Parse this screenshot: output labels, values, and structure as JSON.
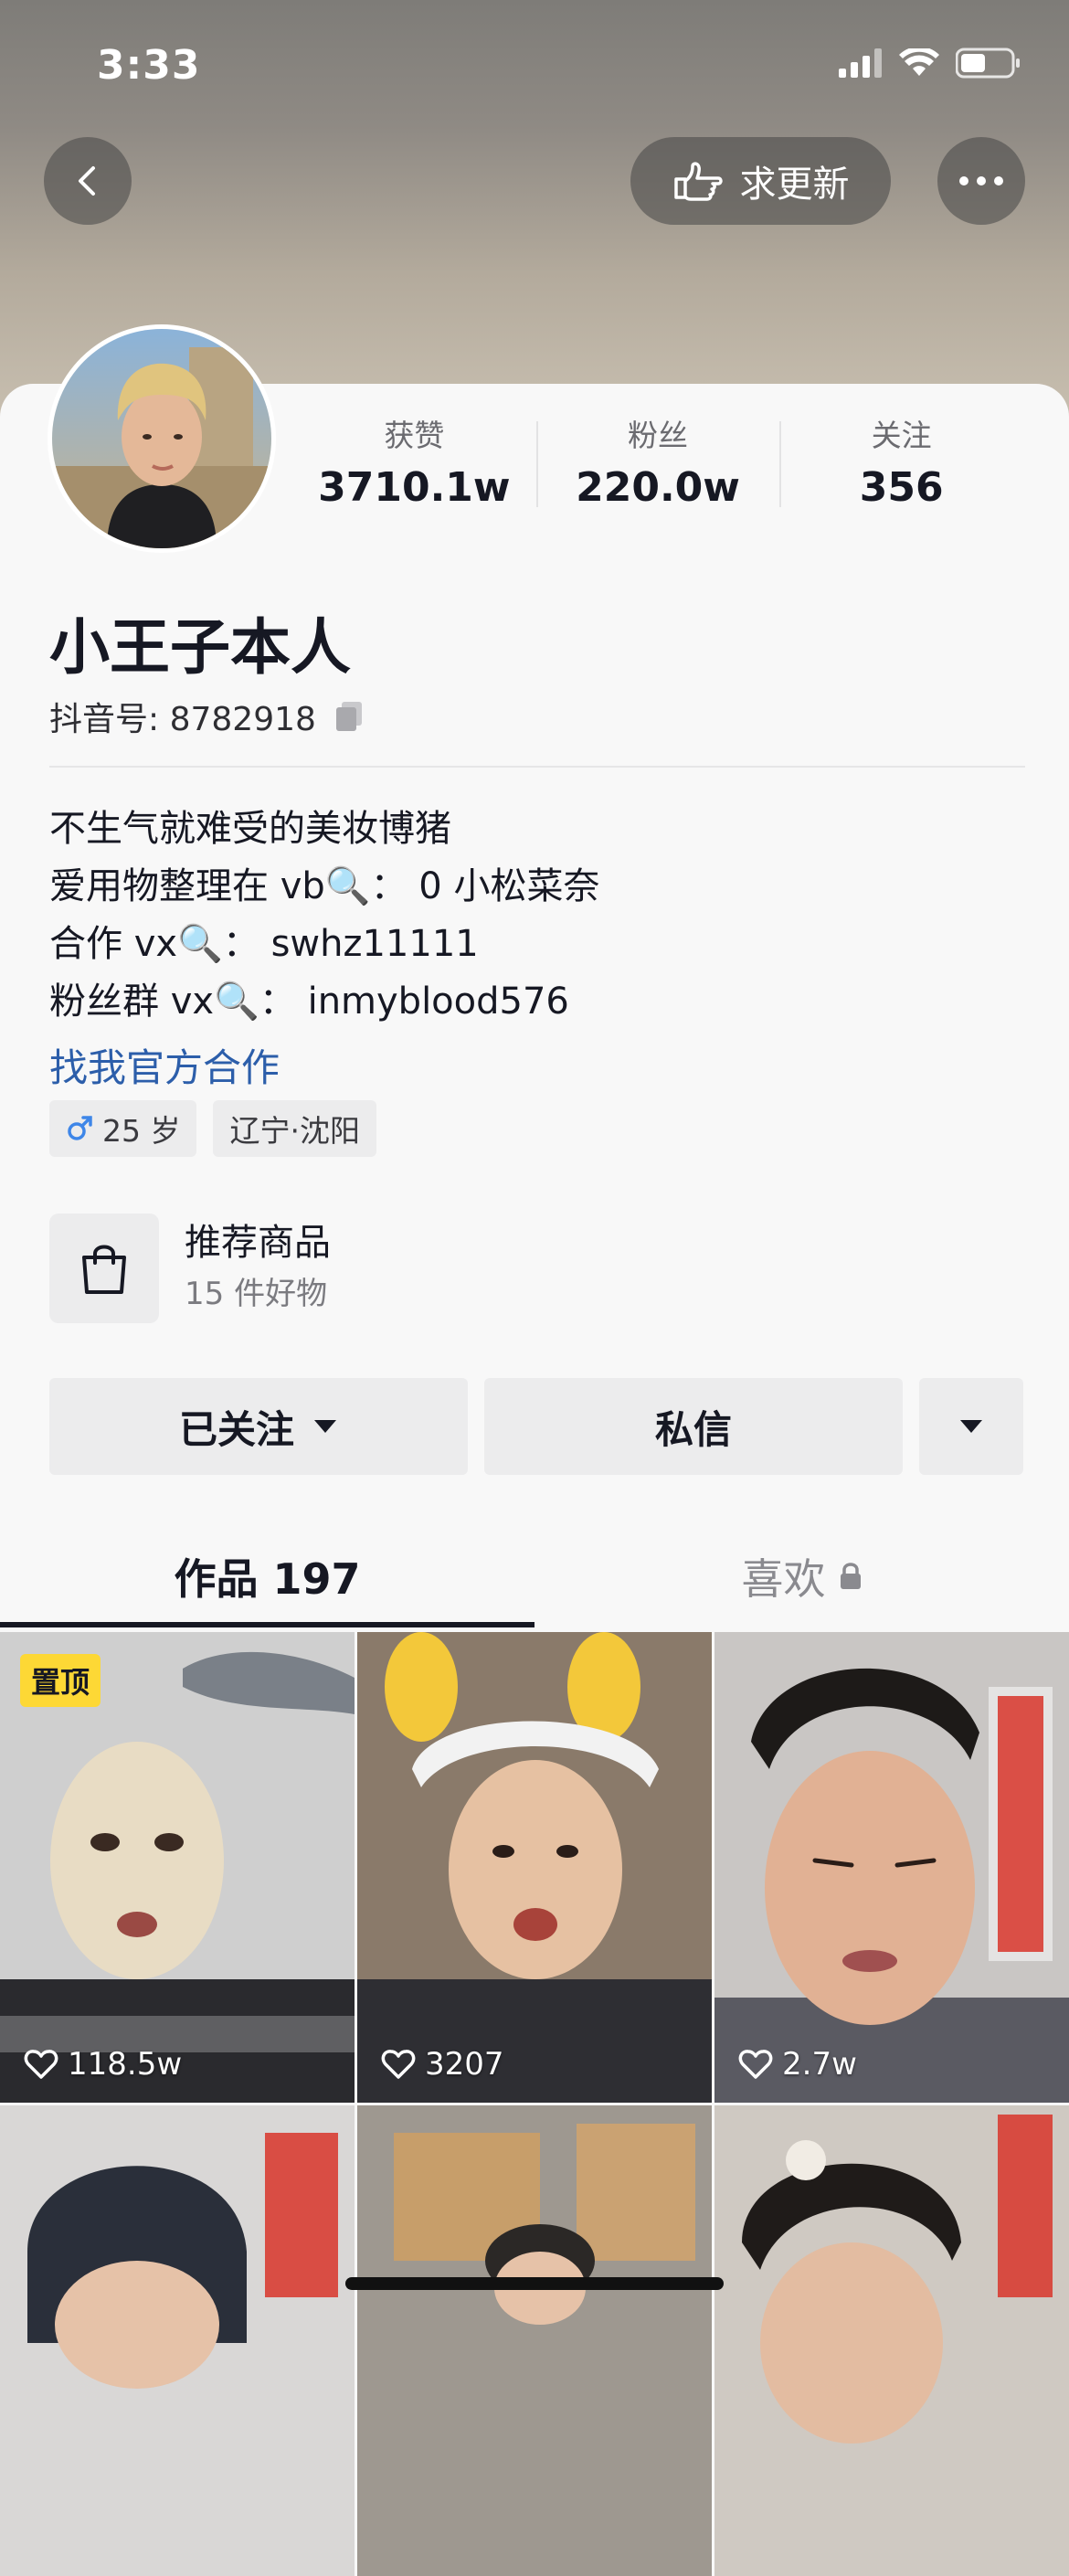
{
  "status_bar": {
    "time": "3:33"
  },
  "nav": {
    "update_label": "求更新"
  },
  "profile": {
    "stats": [
      {
        "label": "获赞",
        "value": "3710.1w"
      },
      {
        "label": "粉丝",
        "value": "220.0w"
      },
      {
        "label": "关注",
        "value": "356"
      }
    ],
    "name": "小王子本人",
    "douyin_id": "抖音号: 8782918",
    "bio_lines": [
      "不生气就难受的美妆博猪",
      "爱用物整理在 vb🔍： 0 小松菜奈",
      "合作 vx🔍： swhz11111",
      "粉丝群 vx🔍： inmyblood576"
    ],
    "link": "找我官方合作",
    "tags": [
      {
        "icon": "male-icon",
        "label": "25 岁"
      },
      {
        "icon": "",
        "label": "辽宁·沈阳"
      }
    ]
  },
  "product": {
    "title": "推荐商品",
    "subtitle": "15 件好物"
  },
  "actions": {
    "follow": "已关注",
    "message": "私信"
  },
  "tabs": {
    "works": "作品 197",
    "likes": "喜欢"
  },
  "videos": [
    {
      "pinned": "置顶",
      "likes": "118.5w"
    },
    {
      "likes": "3207"
    },
    {
      "likes": "2.7w"
    },
    {},
    {},
    {}
  ],
  "colors": {
    "accent_link": "#2c5eaa",
    "pin_badge": "#fdd835",
    "text": "#161823"
  }
}
